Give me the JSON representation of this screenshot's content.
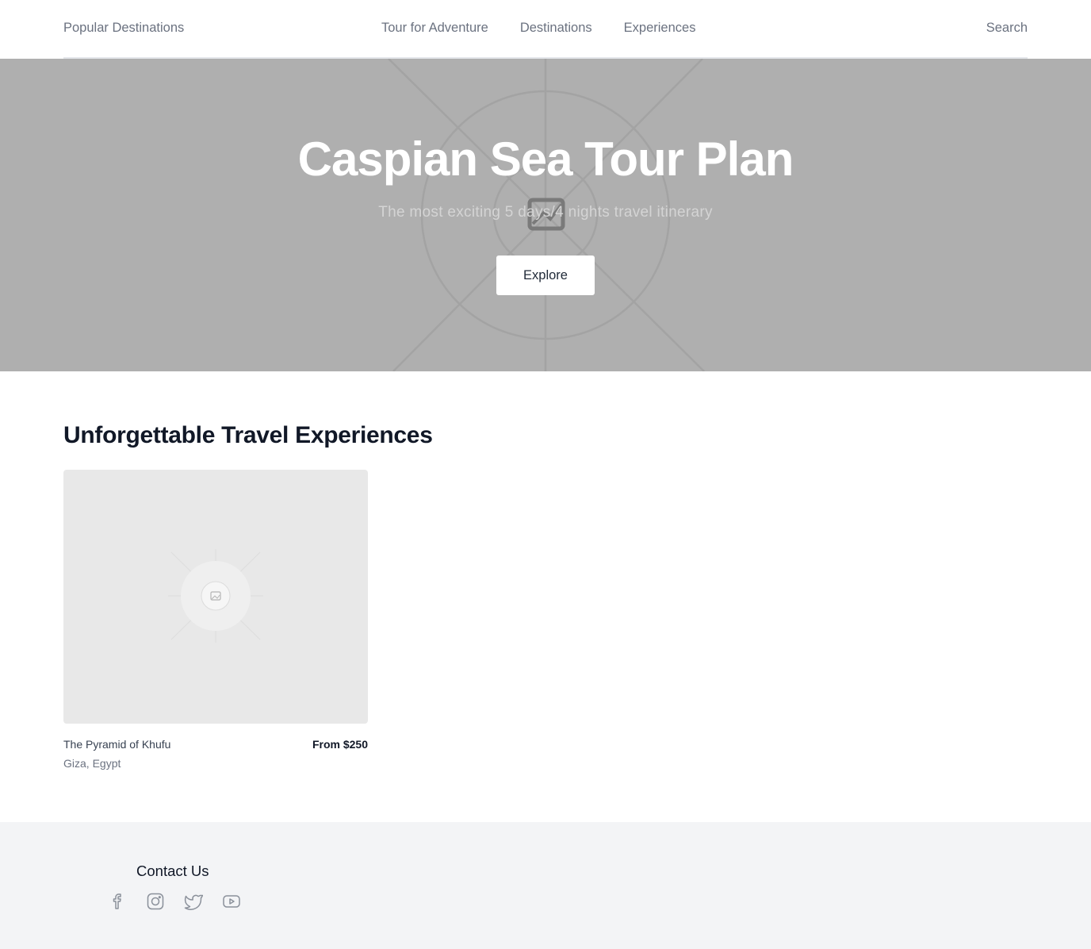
{
  "nav": {
    "brand": "Popular Destinations",
    "links": [
      "Tour for Adventure",
      "Destinations",
      "Experiences"
    ],
    "search": "Search"
  },
  "hero": {
    "title": "Caspian Sea Tour Plan",
    "subtitle": "The most exciting 5 days/4 nights travel itinerary",
    "button": "Explore",
    "image_icon": "image-placeholder-icon"
  },
  "section": {
    "title": "Unforgettable Travel Experiences"
  },
  "cards": [
    {
      "name": "The Pyramid of Khufu",
      "price": "From $250",
      "location": "Giza, Egypt",
      "image_icon": "image-placeholder-icon"
    }
  ],
  "footer": {
    "title": "Contact Us",
    "social": [
      "facebook-icon",
      "instagram-icon",
      "twitter-icon",
      "youtube-icon"
    ]
  },
  "colors": {
    "hero_bg": "#afafaf",
    "footer_bg": "#f3f4f6",
    "text_muted": "#6b7280",
    "text_dark": "#111827"
  }
}
